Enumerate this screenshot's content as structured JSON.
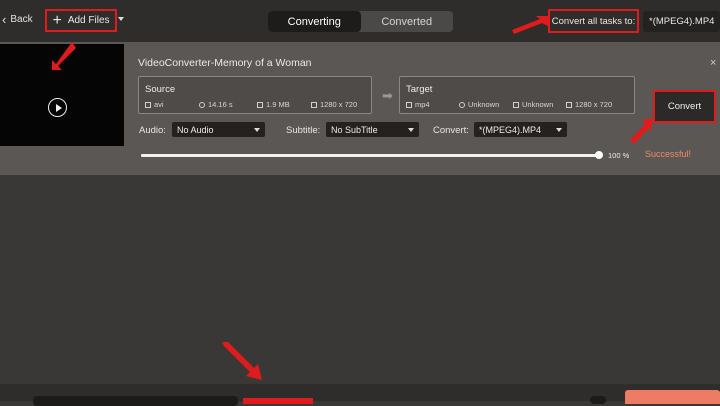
{
  "topbar": {
    "back_label": "Back",
    "add_files_label": "Add Files",
    "tabs": [
      {
        "label": "Converting",
        "active": true
      },
      {
        "label": "Converted",
        "active": false
      }
    ],
    "convert_all_label": "Convert all tasks to:",
    "convert_all_format": "*(MPEG4).MP4"
  },
  "task": {
    "title": "VideoConverter-Memory of a Woman",
    "source": {
      "label": "Source",
      "format": "avi",
      "duration": "14.16 s",
      "size": "1.9 MB",
      "resolution": "1280 x 720"
    },
    "target": {
      "label": "Target",
      "format": "mp4",
      "duration": "Unknown",
      "size": "Unknown",
      "resolution": "1280 x 720"
    },
    "audio_label": "Audio:",
    "audio_value": "No Audio",
    "subtitle_label": "Subtitle:",
    "subtitle_value": "No SubTitle",
    "convert_label": "Convert:",
    "convert_value": "*(MPEG4).MP4",
    "progress_percent": 100,
    "progress_text": "100 %",
    "convert_button": "Convert",
    "status": "Successful!"
  },
  "colors": {
    "annotation_red": "#e01b1b",
    "success": "#f08a63",
    "convert_all_button": "#ee7b64"
  }
}
